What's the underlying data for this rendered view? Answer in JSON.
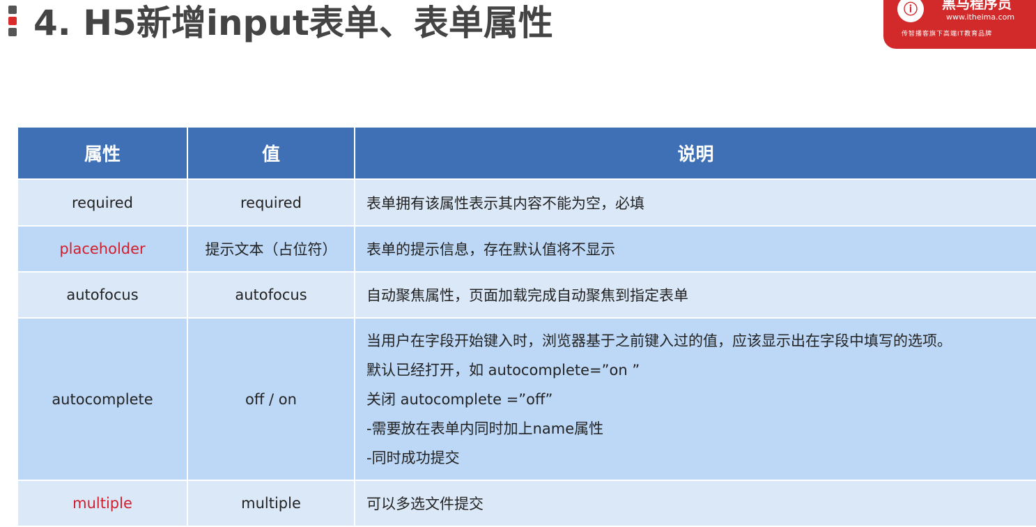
{
  "header": {
    "title": "4. H5新增input表单、表单属性"
  },
  "logo": {
    "name": "黑马程序员",
    "url": "www.itheima.com",
    "slogan": "传智播客旗下高端IT教育品牌"
  },
  "table": {
    "headers": [
      "属性",
      "值",
      "说明"
    ],
    "rows": [
      {
        "attribute": "required",
        "value": "required",
        "description": [
          "表单拥有该属性表示其内容不能为空，必填"
        ],
        "highlight": false
      },
      {
        "attribute": "placeholder",
        "value": "提示文本（占位符）",
        "description": [
          "表单的提示信息，存在默认值将不显示"
        ],
        "highlight": true
      },
      {
        "attribute": "autofocus",
        "value": "autofocus",
        "description": [
          "自动聚焦属性，页面加载完成自动聚焦到指定表单"
        ],
        "highlight": false
      },
      {
        "attribute": "autocomplete",
        "value": "off / on",
        "description": [
          "当用户在字段开始键入时，浏览器基于之前键入过的值，应该显示出在字段中填写的选项。",
          "默认已经打开，如 autocomplete=”on ”",
          "关闭 autocomplete =”off”",
          "-需要放在表单内同时加上name属性",
          "-同时成功提交"
        ],
        "highlight": false
      },
      {
        "attribute": "multiple",
        "value": "multiple",
        "description": [
          "可以多选文件提交"
        ],
        "highlight": true
      }
    ]
  },
  "colors": {
    "header_bg": "#3f6fb4",
    "row_light": "#dbe8f7",
    "row_dark": "#bcd8f6",
    "highlight_text": "#d11e2c",
    "logo_bg": "#d22a2a"
  }
}
